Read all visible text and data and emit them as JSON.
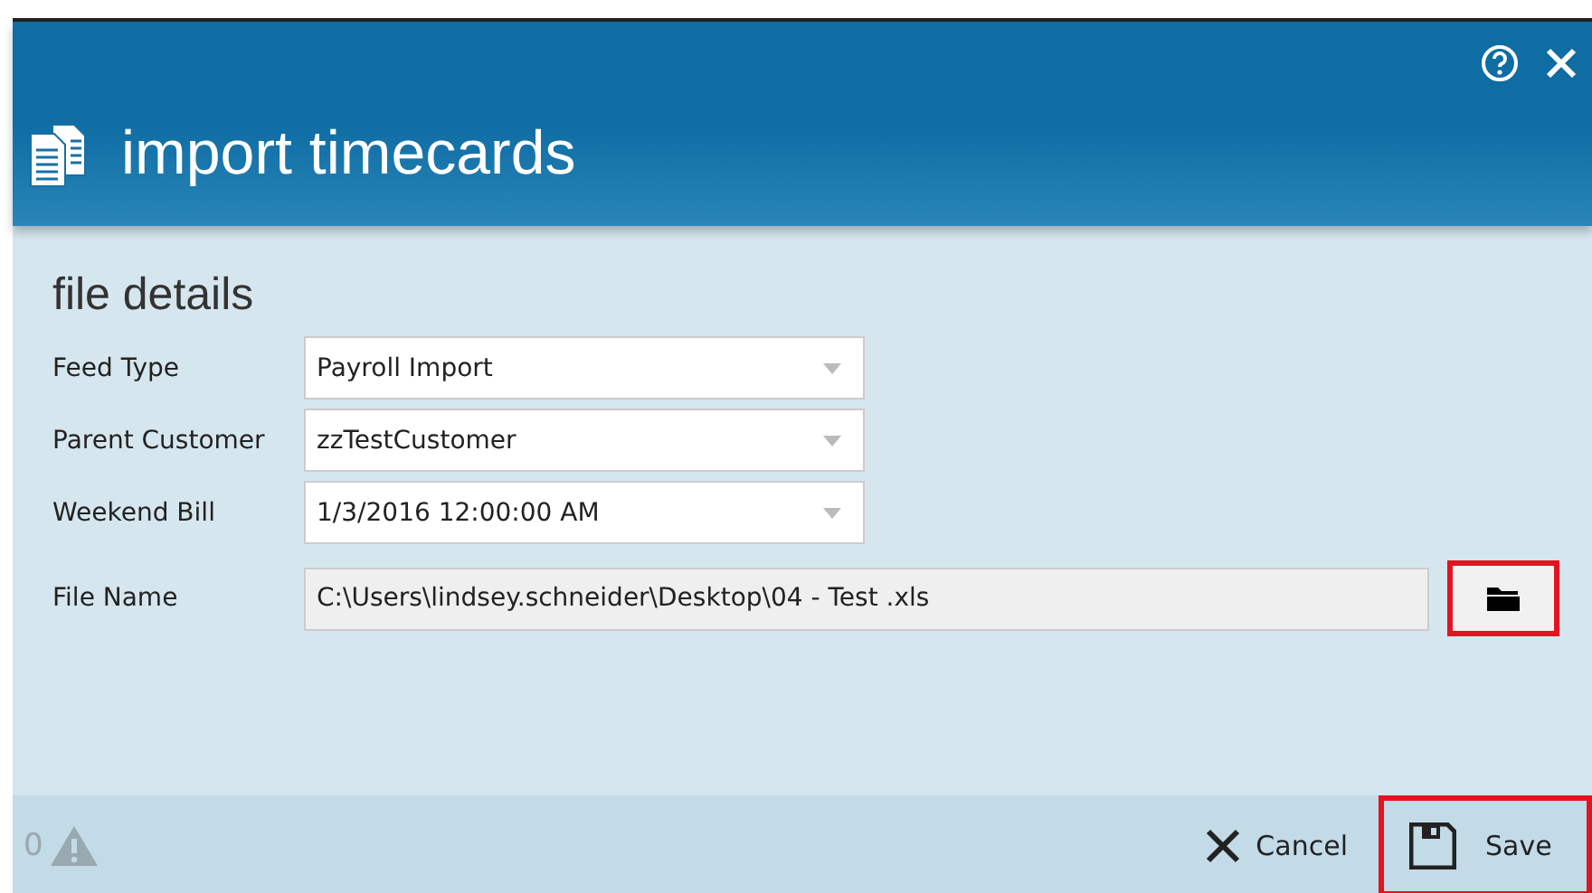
{
  "window": {
    "title": "import timecards"
  },
  "section": {
    "title": "file details"
  },
  "fields": [
    {
      "kind": "select",
      "label": "Feed Type",
      "value": "Payroll Import"
    },
    {
      "kind": "select",
      "label": "Parent Customer",
      "value": "zzTestCustomer"
    },
    {
      "kind": "select",
      "label": "Weekend Bill",
      "value": "1/3/2016 12:00:00 AM"
    },
    {
      "kind": "file",
      "label": "File Name",
      "value": "C:\\Users\\lindsey.schneider\\Desktop\\04 - Test .xls",
      "browse_highlighted": true
    }
  ],
  "footer": {
    "warning_count": "0",
    "cancel": {
      "label": "Cancel",
      "highlighted": false
    },
    "save": {
      "label": "Save",
      "highlighted": true
    }
  }
}
